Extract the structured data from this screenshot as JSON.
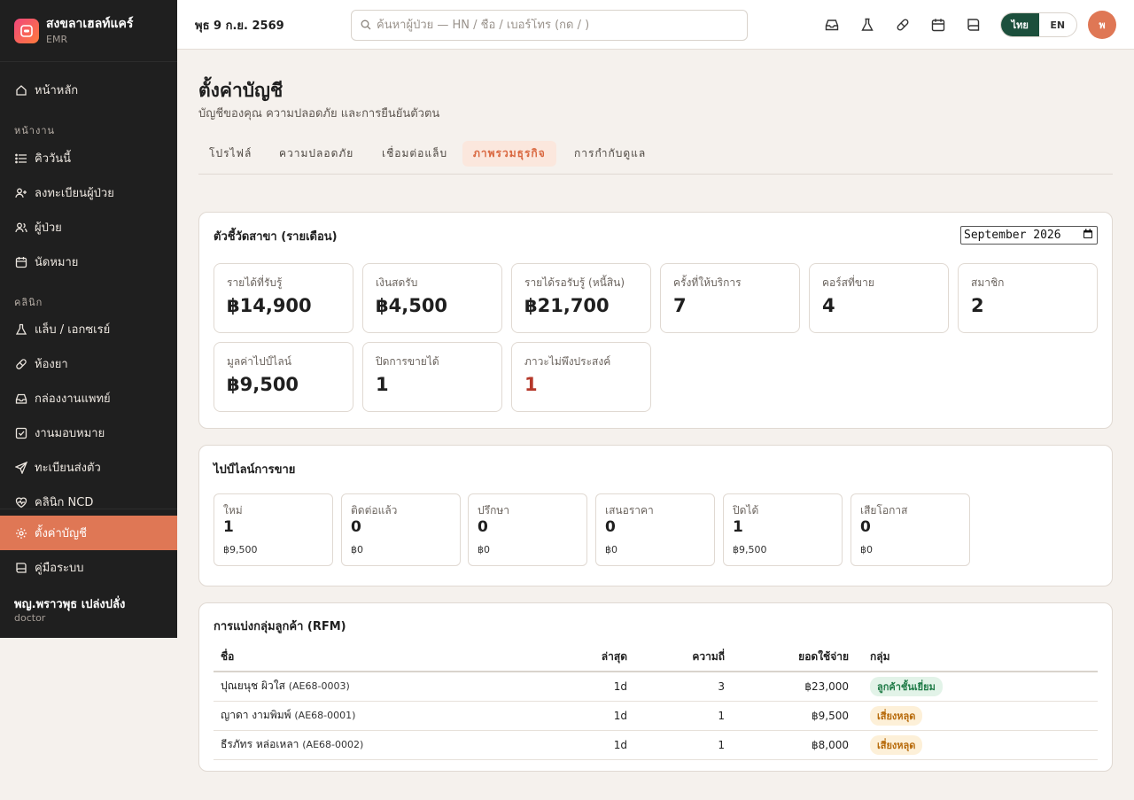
{
  "brand": {
    "name": "สงขลาเฮลท์แคร์",
    "sub": "EMR"
  },
  "nav": {
    "home": "หน้าหลัก",
    "section_work": "หน้างาน",
    "queue": "คิววันนี้",
    "register": "ลงทะเบียนผู้ป่วย",
    "patients": "ผู้ป่วย",
    "appointments": "นัดหมาย",
    "section_clinic": "คลินิก",
    "lab": "แล็บ / เอกซเรย์",
    "pharmacy": "ห้องยา",
    "doctor_inbox": "กล่องงานแพทย์",
    "tasks": "งานมอบหมาย",
    "referrals": "ทะเบียนส่งตัว",
    "ncd": "คลินิก NCD",
    "settings": "ตั้งค่าบัญชี",
    "manual": "คู่มือระบบ"
  },
  "user": {
    "name": "พญ.พราวพุธ เปล่งปลั่ง",
    "role": "doctor",
    "initial": "พ"
  },
  "topbar": {
    "date": "พุธ 9 ก.ย. 2569",
    "search_placeholder": "ค้นหาผู้ป่วย — HN / ชื่อ / เบอร์โทร (กด / )",
    "lang_th": "ไทย",
    "lang_en": "EN"
  },
  "page": {
    "title": "ตั้งค่าบัญชี",
    "subtitle": "บัญชีของคุณ ความปลอดภัย และการยืนยันตัวตน",
    "tabs": [
      "โปรไฟล์",
      "ความปลอดภัย",
      "เชื่อมต่อแล็บ",
      "ภาพรวมธุรกิจ",
      "การกำกับดูแล"
    ]
  },
  "kpi_card": {
    "title": "ตัวชี้วัดสาขา (รายเดือน)",
    "month": "September 2026",
    "items": [
      {
        "label": "รายได้ที่รับรู้",
        "value": "฿14,900"
      },
      {
        "label": "เงินสดรับ",
        "value": "฿4,500"
      },
      {
        "label": "รายได้รอรับรู้ (หนี้สิน)",
        "value": "฿21,700"
      },
      {
        "label": "ครั้งที่ให้บริการ",
        "value": "7"
      },
      {
        "label": "คอร์สที่ขาย",
        "value": "4"
      },
      {
        "label": "สมาชิก",
        "value": "2"
      },
      {
        "label": "มูลค่าไปป์ไลน์",
        "value": "฿9,500"
      },
      {
        "label": "ปิดการขายได้",
        "value": "1"
      },
      {
        "label": "ภาวะไม่พึงประสงค์",
        "value": "1"
      }
    ]
  },
  "pipeline": {
    "title": "ไปป์ไลน์การขาย",
    "stages": [
      {
        "label": "ใหม่",
        "count": "1",
        "amount": "฿9,500"
      },
      {
        "label": "ติดต่อแล้ว",
        "count": "0",
        "amount": "฿0"
      },
      {
        "label": "ปรึกษา",
        "count": "0",
        "amount": "฿0"
      },
      {
        "label": "เสนอราคา",
        "count": "0",
        "amount": "฿0"
      },
      {
        "label": "ปิดได้",
        "count": "1",
        "amount": "฿9,500"
      },
      {
        "label": "เสียโอกาส",
        "count": "0",
        "amount": "฿0"
      }
    ]
  },
  "rfm": {
    "title": "การแบ่งกลุ่มลูกค้า (RFM)",
    "headers": [
      "ชื่อ",
      "ล่าสุด",
      "ความถี่",
      "ยอดใช้จ่าย",
      "กลุ่ม"
    ],
    "rows": [
      {
        "name": "ปุณยนุช ผิวใส",
        "code": "(AE68-0003)",
        "recency": "1d",
        "frequency": "3",
        "spend": "฿23,000",
        "segment": "ลูกค้าชั้นเยี่ยม",
        "segment_type": "good"
      },
      {
        "name": "ญาดา งามพิมพ์",
        "code": "(AE68-0001)",
        "recency": "1d",
        "frequency": "1",
        "spend": "฿9,500",
        "segment": "เสี่ยงหลุด",
        "segment_type": "risk"
      },
      {
        "name": "ธีรภัทร หล่อเหลา",
        "code": "(AE68-0002)",
        "recency": "1d",
        "frequency": "1",
        "spend": "฿8,000",
        "segment": "เสี่ยงหลุด",
        "segment_type": "risk"
      }
    ]
  },
  "colors": {
    "accent": "#df7755",
    "sidebar": "#1f1f1f",
    "lang_active": "#1c4f3c",
    "danger": "#b5382a"
  }
}
